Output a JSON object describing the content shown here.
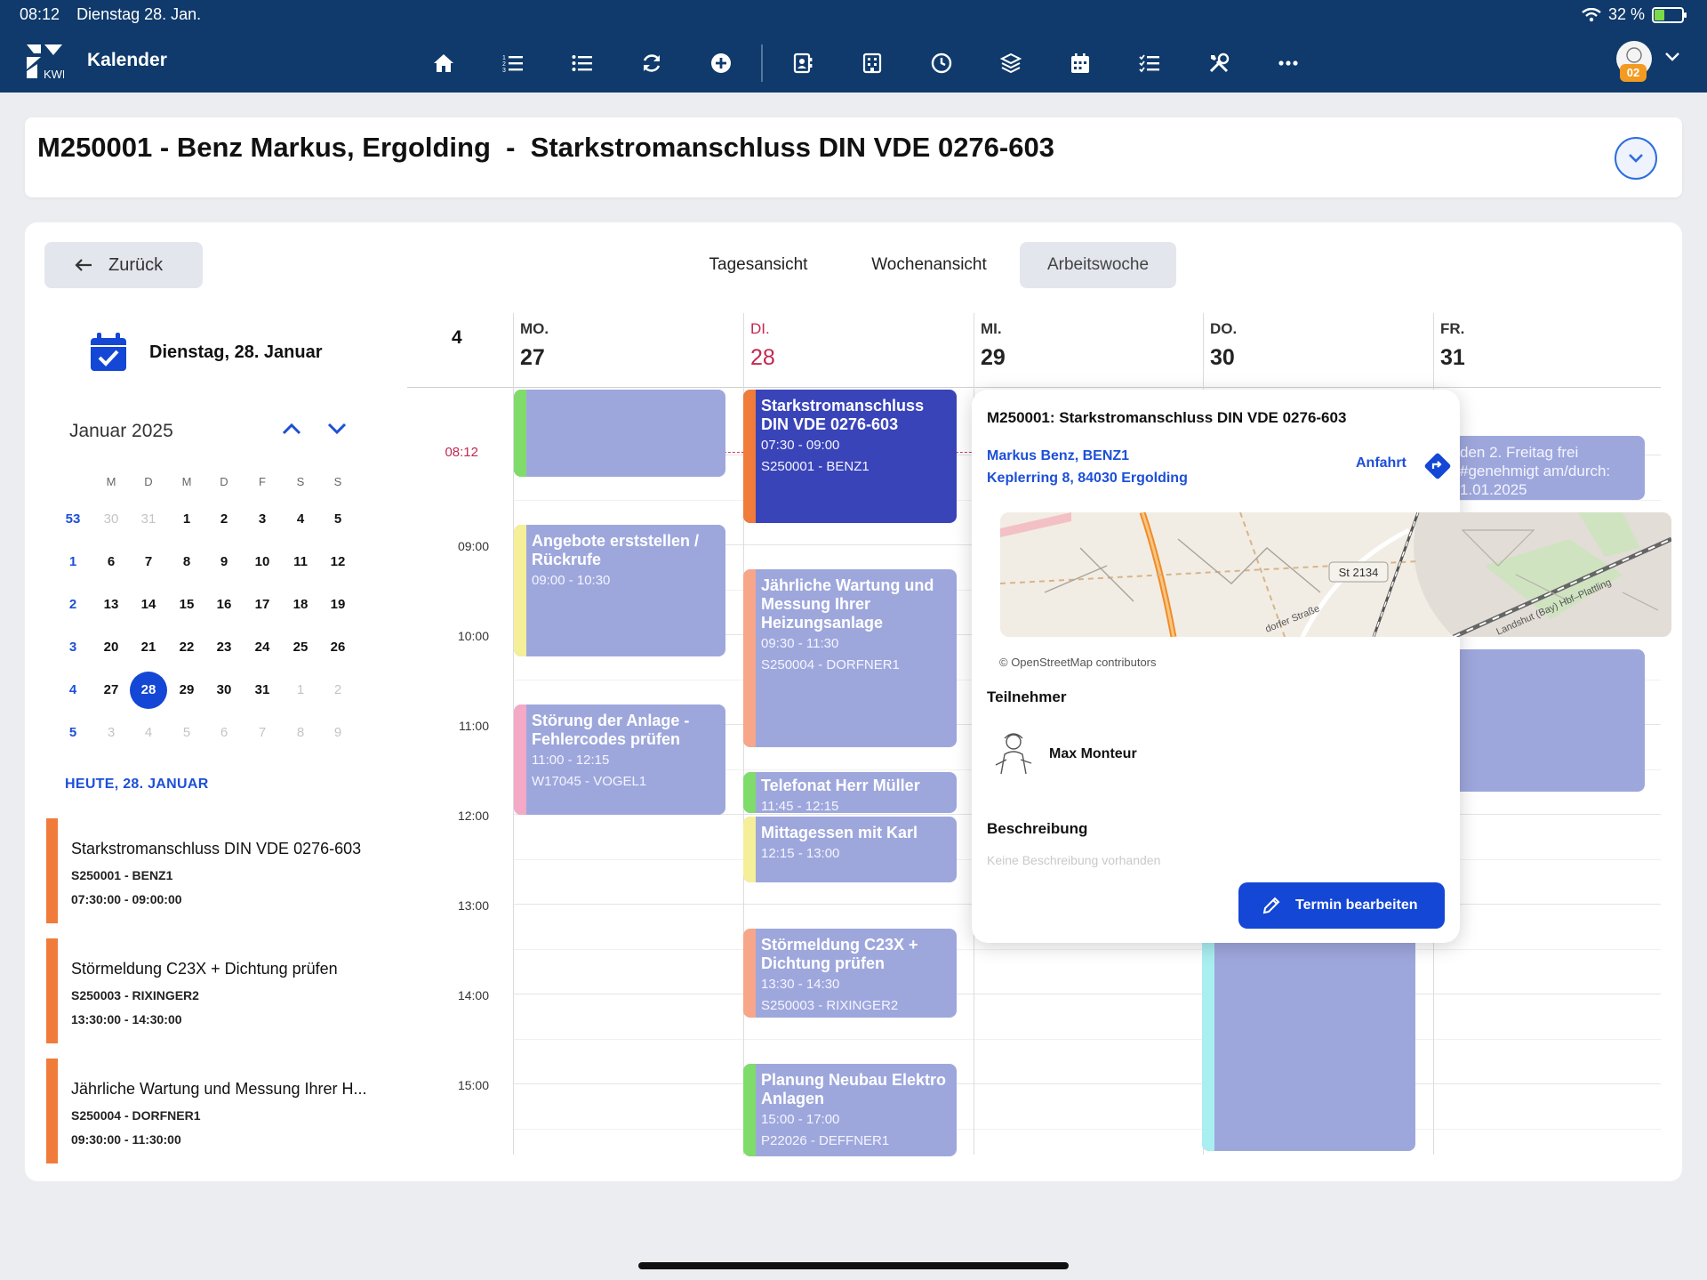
{
  "status_bar": {
    "time": "08:12",
    "date": "Dienstag 28. Jan.",
    "battery": "32 %"
  },
  "app": {
    "title": "Kalender",
    "user_badge": "02"
  },
  "nav_icons": [
    "home-icon",
    "numbered-list-icon",
    "list-icon",
    "sync-icon",
    "add-circle-icon",
    "contact-book-icon",
    "building-icon",
    "clock-icon",
    "layers-icon",
    "calendar-icon",
    "checklist-icon",
    "tools-icon",
    "more-icon"
  ],
  "title_card": {
    "text": "M250001 - Benz Markus, Ergolding  -  Starkstromanschluss DIN VDE 0276-603"
  },
  "back_label": "Zurück",
  "view_tabs": [
    {
      "label": "Tagesansicht",
      "active": false
    },
    {
      "label": "Wochenansicht",
      "active": false
    },
    {
      "label": "Arbeitswoche",
      "active": true
    }
  ],
  "sidebar": {
    "date_heading": "Dienstag, 28. Januar",
    "month_label": "Januar 2025",
    "weekday_headers": [
      "M",
      "D",
      "M",
      "D",
      "F",
      "S",
      "S"
    ],
    "weeks": [
      {
        "kw": "53",
        "days": [
          "30",
          "31",
          "1",
          "2",
          "3",
          "4",
          "5"
        ]
      },
      {
        "kw": "1",
        "days": [
          "6",
          "7",
          "8",
          "9",
          "10",
          "11",
          "12"
        ]
      },
      {
        "kw": "2",
        "days": [
          "13",
          "14",
          "15",
          "16",
          "17",
          "18",
          "19"
        ]
      },
      {
        "kw": "3",
        "days": [
          "20",
          "21",
          "22",
          "23",
          "24",
          "25",
          "26"
        ]
      },
      {
        "kw": "4",
        "days": [
          "27",
          "28",
          "29",
          "30",
          "31",
          "1",
          "2"
        ]
      },
      {
        "kw": "5",
        "days": [
          "3",
          "4",
          "5",
          "6",
          "7",
          "8",
          "9"
        ]
      }
    ],
    "selected_day": "28",
    "today_label": "HEUTE, 28. JANUAR",
    "agenda": [
      {
        "title": "Starkstromanschluss DIN VDE 0276-603",
        "sub": "S250001 - BENZ1",
        "time": "07:30:00 - 09:00:00"
      },
      {
        "title": "Störmeldung C23X + Dichtung prüfen",
        "sub": "S250003 - RIXINGER2",
        "time": "13:30:00 - 14:30:00"
      },
      {
        "title": "Jährliche Wartung und Messung Ihrer H...",
        "sub": "S250004 - DORFNER1",
        "time": "09:30:00 - 11:30:00"
      }
    ]
  },
  "calendar": {
    "week_number": "4",
    "days": [
      {
        "dow": "MO.",
        "num": "27"
      },
      {
        "dow": "DI.",
        "num": "28"
      },
      {
        "dow": "MI.",
        "num": "29"
      },
      {
        "dow": "DO.",
        "num": "30"
      },
      {
        "dow": "FR.",
        "num": "31"
      }
    ],
    "current_time": "08:12",
    "hours": [
      "09:00",
      "10:00",
      "11:00",
      "12:00",
      "13:00",
      "14:00",
      "15:00"
    ],
    "events": {
      "mon_1": {
        "title": "",
        "lines": []
      },
      "mon_2": {
        "title": "Angebote erststellen / Rückrufe",
        "lines": [
          "09:00 - 10:30"
        ]
      },
      "mon_3": {
        "title": "Störung der Anlage - Fehlercodes prüfen",
        "lines": [
          "11:00 - 12:15",
          "W17045 - VOGEL1"
        ]
      },
      "tue_1": {
        "title": "Starkstromanschluss DIN VDE 0276-603",
        "lines": [
          "07:30 - 09:00",
          "S250001 - BENZ1"
        ]
      },
      "tue_2": {
        "title": "Jährliche Wartung und Messung Ihrer Heizungsanlage",
        "lines": [
          "09:30 - 11:30",
          "S250004 - DORFNER1"
        ]
      },
      "tue_3": {
        "title": "Telefonat Herr Müller",
        "lines": [
          "11:45 - 12:15"
        ]
      },
      "tue_4": {
        "title": "Mittagessen mit Karl",
        "lines": [
          "12:15 - 13:00"
        ]
      },
      "tue_5": {
        "title": "Störmeldung C23X + Dichtung prüfen",
        "lines": [
          "13:30 - 14:30",
          "S250003 - RIXINGER2"
        ]
      },
      "tue_6": {
        "title": "Planung Neubau Elektro Anlagen",
        "lines": [
          "15:00 - 17:00",
          "P22026 - DEFFNER1"
        ]
      },
      "fri_1": {
        "title": "den 2. Freitag frei #genehmigt am/durch: 1.01.2025",
        "lines": []
      }
    }
  },
  "popover": {
    "title": "M250001: Starkstromanschluss DIN VDE 0276-603",
    "contact_name": "Markus Benz, BENZ1",
    "address": "Keplerring 8, 84030 Ergolding",
    "route_label": "Anfahrt",
    "map_labels": [
      "St 2134",
      "dorfer Straße",
      "Landshut (Bay) Hbf–Plattling"
    ],
    "map_credit": "© OpenStreetMap contributors",
    "participants_label": "Teilnehmer",
    "participant": "Max Monteur",
    "description_label": "Beschreibung",
    "description_empty": "Keine Beschreibung vorhanden",
    "edit_button": "Termin bearbeiten"
  },
  "colors": {
    "primary": "#1447d6",
    "appbar": "#0f3a6b",
    "event": "#9ea7dc",
    "event_selected": "#3a44b9",
    "today": "#c3284f",
    "agenda_bar": "#f07b3a"
  }
}
